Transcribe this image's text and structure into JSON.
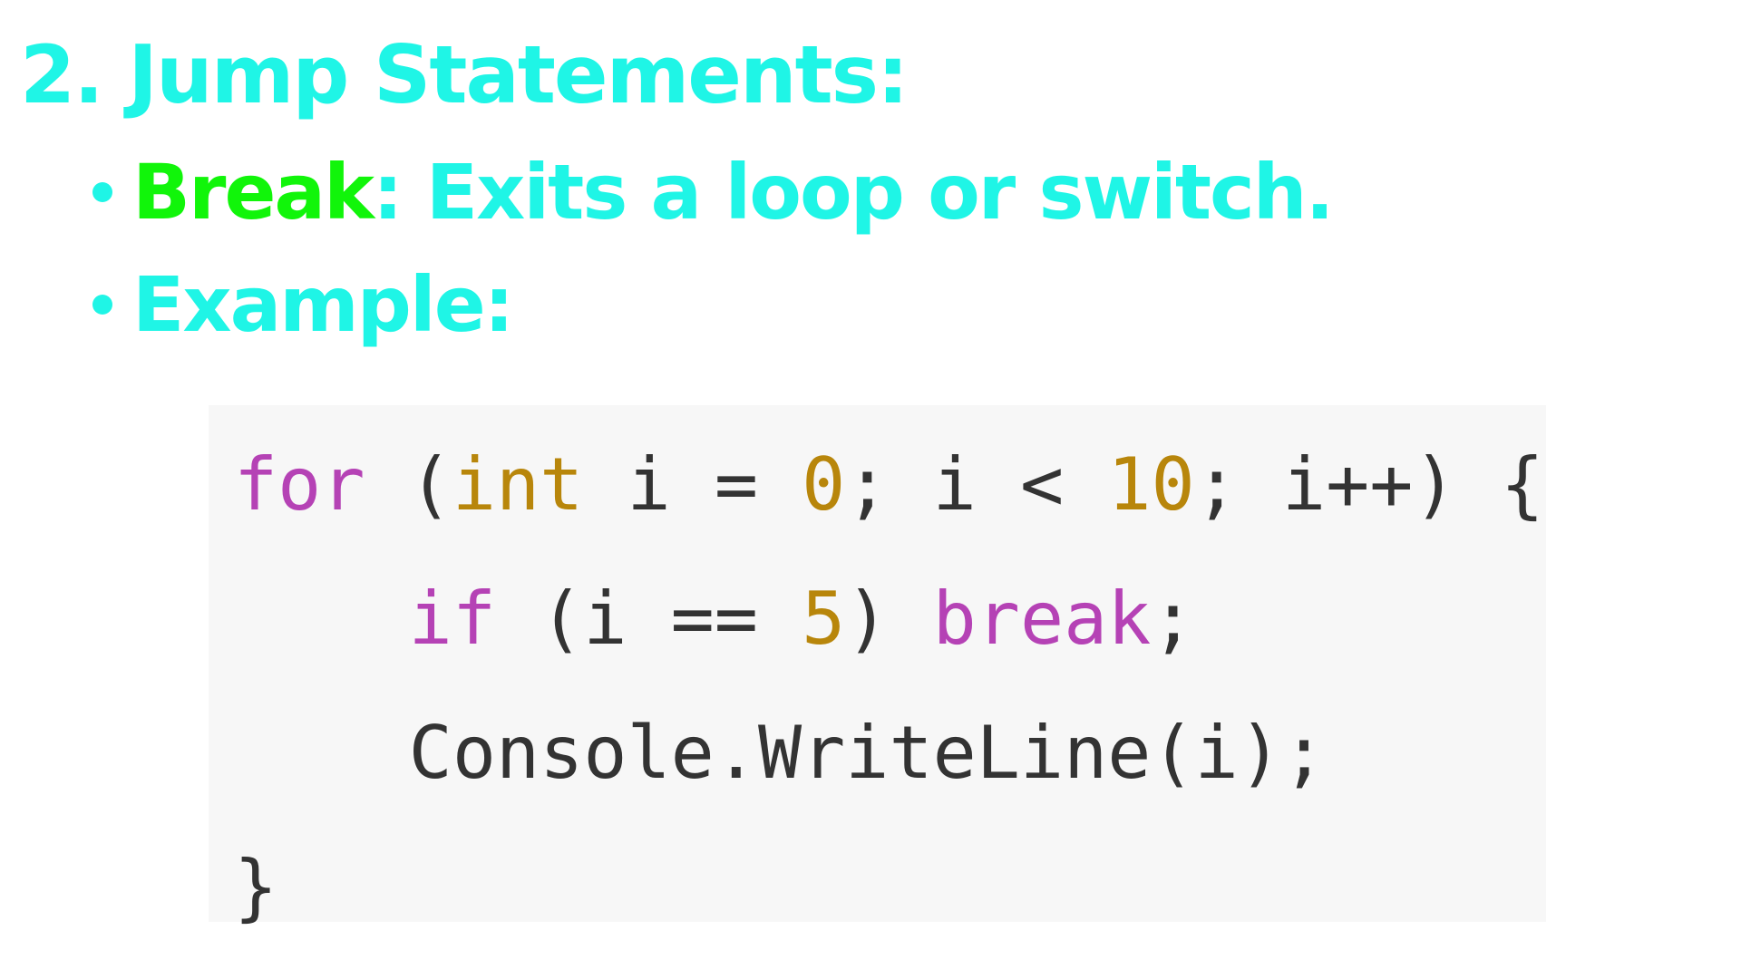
{
  "heading": {
    "text": "2. Jump Statements:"
  },
  "bullets": [
    {
      "term": "Break",
      "text": ": Exits a loop or switch."
    },
    {
      "text": "Example:"
    }
  ],
  "code": {
    "lines": [
      [
        {
          "text": "for",
          "kind": "keyword"
        },
        {
          "text": " (",
          "kind": "plain"
        },
        {
          "text": "int",
          "kind": "type"
        },
        {
          "text": " i = ",
          "kind": "plain"
        },
        {
          "text": "0",
          "kind": "number"
        },
        {
          "text": "; i < ",
          "kind": "plain"
        },
        {
          "text": "10",
          "kind": "number"
        },
        {
          "text": "; i++) {",
          "kind": "plain"
        }
      ],
      [
        {
          "text": "    ",
          "kind": "plain"
        },
        {
          "text": "if",
          "kind": "keyword"
        },
        {
          "text": " (i == ",
          "kind": "plain"
        },
        {
          "text": "5",
          "kind": "number"
        },
        {
          "text": ") ",
          "kind": "plain"
        },
        {
          "text": "break",
          "kind": "keyword"
        },
        {
          "text": ";",
          "kind": "plain"
        }
      ],
      [
        {
          "text": "    Console.WriteLine(i);",
          "kind": "plain"
        }
      ],
      [
        {
          "text": "}",
          "kind": "plain"
        }
      ]
    ]
  },
  "colors": {
    "heading": "#1ff5e6",
    "term": "#11f50a",
    "bullet_text": "#1ff5e6",
    "code_background": "#f7f7f7",
    "code_keyword": "#b542b5",
    "code_type": "#b8860b",
    "code_number": "#b8860b",
    "code_plain": "#333333"
  }
}
